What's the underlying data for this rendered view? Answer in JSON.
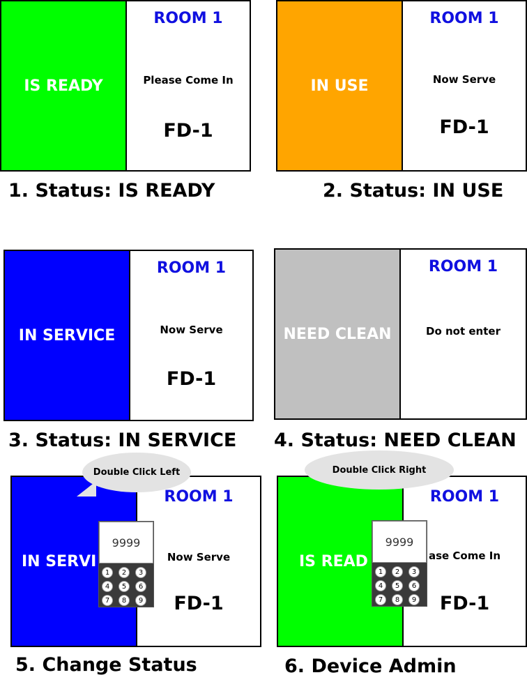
{
  "panels": [
    {
      "status": "IS READY",
      "status_color": "#00ff00",
      "room": "ROOM 1",
      "message": "Please Come In",
      "code": "FD-1",
      "caption": "1. Status: IS READY"
    },
    {
      "status": "IN USE",
      "status_color": "#ffa500",
      "room": "ROOM 1",
      "message": "Now Serve",
      "code": "FD-1",
      "caption": "2. Status: IN USE"
    },
    {
      "status": "IN SERVICE",
      "status_color": "#0000ff",
      "room": "ROOM 1",
      "message": "Now Serve",
      "code": "FD-1",
      "caption": "3. Status: IN SERVICE"
    },
    {
      "status": "NEED CLEAN",
      "status_color": "#c0c0c0",
      "room": "ROOM 1",
      "message": "Do not enter",
      "code": "",
      "caption": "4. Status: NEED CLEAN"
    },
    {
      "status": "IN SERVI",
      "status_color": "#0000ff",
      "room": "ROOM 1",
      "message": "Now Serve",
      "code": "FD-1",
      "caption": "5. Change Status",
      "bubble": "Double Click Left"
    },
    {
      "status": "IS READ",
      "status_color": "#00ff00",
      "room": "ROOM 1",
      "message": "ase Come In",
      "code": "FD-1",
      "caption": "6. Device Admin",
      "bubble": "Double Click Right"
    }
  ],
  "keypads": [
    {
      "display": "9999",
      "keys": [
        "1",
        "2",
        "3",
        "4",
        "5",
        "6",
        "7",
        "8",
        "9"
      ]
    },
    {
      "display": "9999",
      "keys": [
        "1",
        "2",
        "3",
        "4",
        "5",
        "6",
        "7",
        "8",
        "9"
      ]
    }
  ]
}
